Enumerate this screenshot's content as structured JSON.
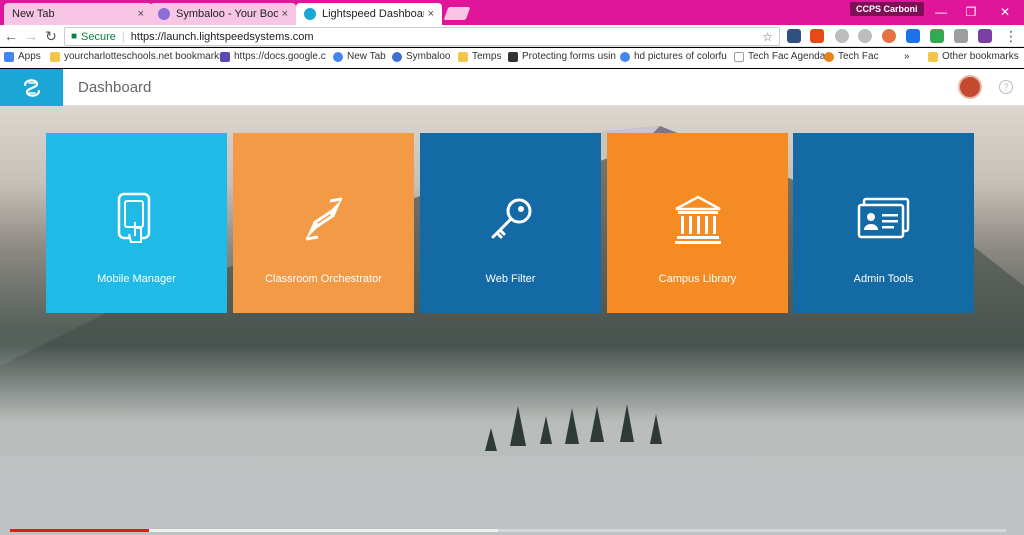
{
  "browser": {
    "tabs": [
      {
        "title": "New Tab",
        "close": "×"
      },
      {
        "title": "Symbaloo - Your Bookm",
        "close": "×"
      },
      {
        "title": "Lightspeed Dashboard",
        "close": "×"
      }
    ],
    "profile": "CCPS Carboni",
    "window_controls": {
      "minimize": "—",
      "maximize": "❐",
      "close": "✕"
    },
    "nav": {
      "back": "←",
      "forward": "→",
      "reload": "↻"
    },
    "address": {
      "secure_label": "Secure",
      "separator": "|",
      "url": "https://launch.lightspeedsystems.com",
      "star": "☆"
    },
    "menu": "⋮"
  },
  "bookmarks": {
    "items": [
      {
        "label": "Apps",
        "icon": "apps-grid-icon",
        "color": "#4285f4"
      },
      {
        "label": "yourcharlotteschools.net bookmarks",
        "icon": "folder-icon",
        "color": "#f5c54a"
      },
      {
        "label": "https://docs.google.c",
        "icon": "docs-icon",
        "color": "#5b4ab3"
      },
      {
        "label": "New Tab",
        "icon": "google-icon",
        "color": "#4285f4"
      },
      {
        "label": "Symbaloo",
        "icon": "symbaloo-icon",
        "color": "#3a6fd4"
      },
      {
        "label": "Temps",
        "icon": "folder-icon",
        "color": "#f5c54a"
      },
      {
        "label": "Protecting forms usin",
        "icon": "linux-icon",
        "color": "#333333"
      },
      {
        "label": "hd pictures of colorfu",
        "icon": "google-icon",
        "color": "#4285f4"
      },
      {
        "label": "Tech Fac Agenda",
        "icon": "page-icon",
        "color": "#9e9e9e"
      },
      {
        "label": "Tech Fac",
        "icon": "settings-icon",
        "color": "#e8811a"
      }
    ],
    "overflow": "»",
    "other_label": "Other bookmarks"
  },
  "app": {
    "title": "Dashboard",
    "help": "?"
  },
  "tiles": [
    {
      "label": "Mobile Manager",
      "icon": "tablet-hand-icon",
      "color": "#1fbbe6"
    },
    {
      "label": "Classroom Orchestrator",
      "icon": "arrows-icon",
      "color": "#f29a45"
    },
    {
      "label": "Web Filter",
      "icon": "key-icon",
      "color": "#136aa5"
    },
    {
      "label": "Campus Library",
      "icon": "library-icon",
      "color": "#f58b23"
    },
    {
      "label": "Admin Tools",
      "icon": "id-card-icon",
      "color": "#136aa5"
    }
  ],
  "video": {
    "progress": 0.14,
    "buffered": 0.49
  }
}
